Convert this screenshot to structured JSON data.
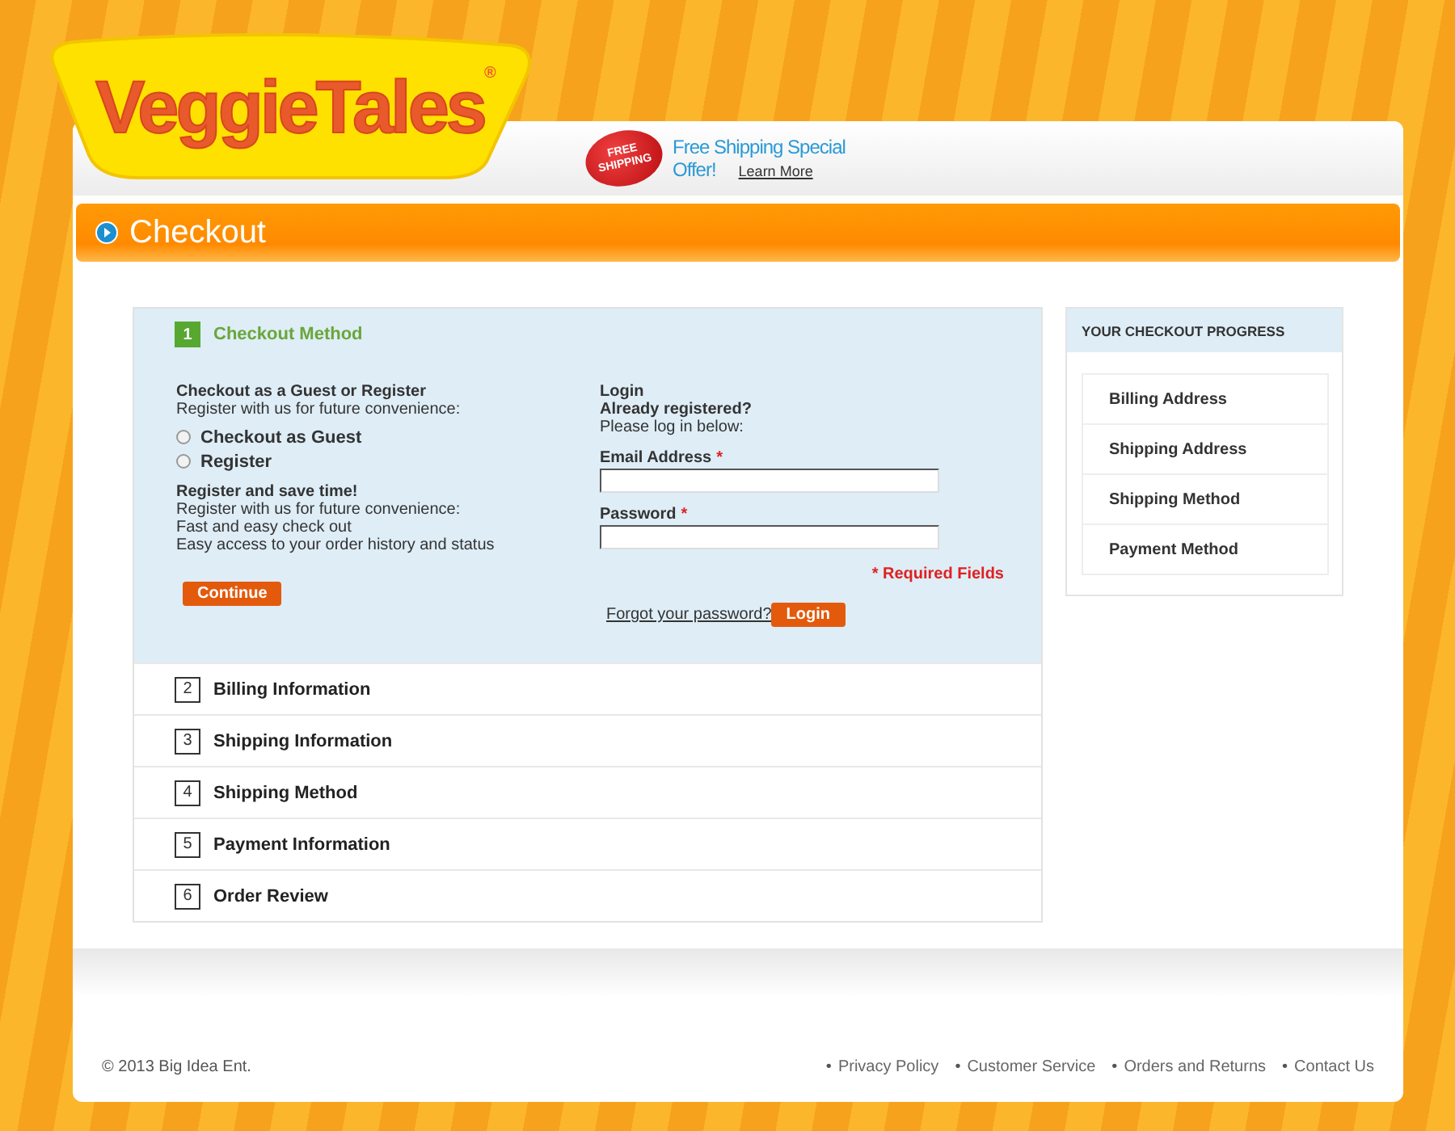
{
  "logo": {
    "text": "VeggieTales",
    "mark": "®"
  },
  "promo": {
    "badge": [
      "FREE",
      "SHIPPING"
    ],
    "lines": [
      "Free Shipping Special",
      "Offer!"
    ],
    "link": "Learn More"
  },
  "page_title": "Checkout",
  "steps": [
    {
      "number": "1",
      "title": "Checkout Method",
      "expanded": true
    },
    {
      "number": "2",
      "title": "Billing Information",
      "expanded": false
    },
    {
      "number": "3",
      "title": "Shipping Information",
      "expanded": false
    },
    {
      "number": "4",
      "title": "Shipping Method",
      "expanded": false
    },
    {
      "number": "5",
      "title": "Payment Information",
      "expanded": false
    },
    {
      "number": "6",
      "title": "Order Review",
      "expanded": false
    }
  ],
  "checkout_method": {
    "guest_heading": "Checkout as a Guest or Register",
    "guest_intro": "Register with us for future convenience:",
    "options": [
      {
        "label": "Checkout as Guest",
        "checked": false
      },
      {
        "label": "Register",
        "checked": false
      }
    ],
    "benefits_heading": "Register and save time!",
    "benefits": [
      "Register with us for future convenience:",
      "Fast and easy check out",
      "Easy access to your order history and status"
    ],
    "continue_button": "Continue",
    "login_heading": "Login",
    "login_subheading": "Already registered?",
    "login_intro": "Please log in below:",
    "fields": [
      {
        "label": "Email Address",
        "required_mark": "*"
      },
      {
        "label": "Password",
        "required_mark": "*"
      }
    ],
    "required_note": "* Required Fields",
    "forgot_link": "Forgot your password?",
    "login_button": "Login"
  },
  "progress": {
    "title": "YOUR CHECKOUT PROGRESS",
    "items": [
      "Billing Address",
      "Shipping Address",
      "Shipping Method",
      "Payment Method"
    ]
  },
  "footer": {
    "copyright": "© 2013 Big Idea Ent.",
    "bullet": "•",
    "links": [
      "Privacy Policy",
      "Customer Service",
      "Orders and Returns",
      "Contact Us"
    ]
  }
}
